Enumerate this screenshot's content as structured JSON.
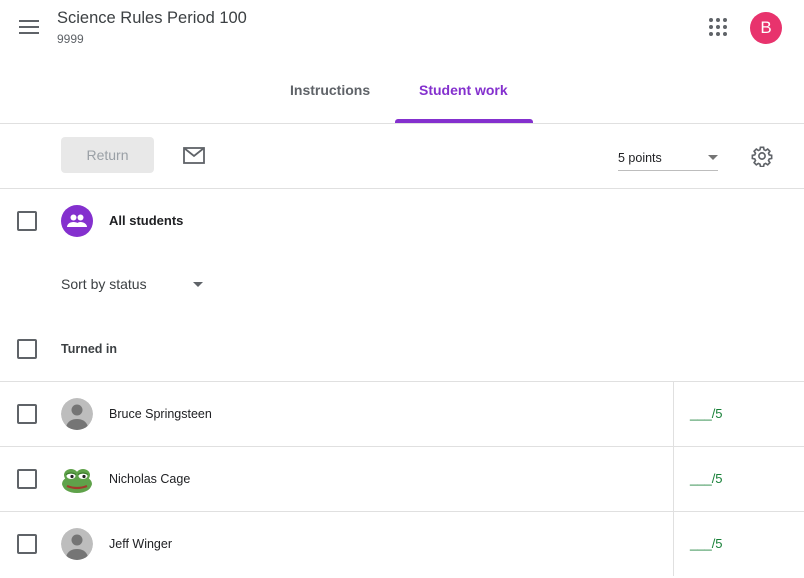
{
  "header": {
    "class_title": "Science Rules Period 100",
    "class_section": "9999",
    "user_initial": "B"
  },
  "tabs": [
    {
      "label": "Instructions",
      "active": false
    },
    {
      "label": "Student work",
      "active": true
    }
  ],
  "toolbar": {
    "return_label": "Return",
    "points_value": "5 points"
  },
  "all_students": {
    "label": "All students"
  },
  "sort": {
    "label": "Sort by status"
  },
  "section": {
    "label": "Turned in"
  },
  "students": [
    {
      "name": "Bruce Springsteen",
      "grade": "___/5",
      "avatar": "default-person-icon"
    },
    {
      "name": "Nicholas Cage",
      "grade": "___/5",
      "avatar": "frog-avatar"
    },
    {
      "name": "Jeff Winger",
      "grade": "___/5",
      "avatar": "default-person-icon"
    }
  ],
  "colors": {
    "accent": "#8430ce",
    "user_avatar": "#e8336d",
    "grade": "#188038"
  }
}
